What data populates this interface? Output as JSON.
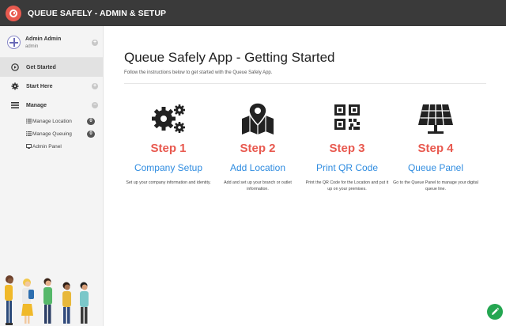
{
  "app": {
    "title": "QUEUE SAFELY - ADMIN & SETUP"
  },
  "user": {
    "name": "Admin Admin",
    "role": "admin"
  },
  "nav": {
    "get_started": "Get Started",
    "start_here": "Start Here",
    "manage": "Manage",
    "manage_items": [
      {
        "label": "Manage Location",
        "count": "0"
      },
      {
        "label": "Manage Queuing",
        "count": "0"
      },
      {
        "label": "Admin Panel"
      }
    ]
  },
  "main": {
    "title": "Queue Safely App - Getting Started",
    "subtitle": "Follow the instructions below to get started with the Queue Safely App.",
    "steps": [
      {
        "icon": "gears-icon",
        "number": "Step 1",
        "link": "Company Setup",
        "description": "Set up your company information and identity."
      },
      {
        "icon": "map-location-icon",
        "number": "Step 2",
        "link": "Add Location",
        "description": "Add and set up your branch or outlet information."
      },
      {
        "icon": "qr-code-icon",
        "number": "Step 3",
        "link": "Print QR Code",
        "description": "Print the QR Code for the Location and put it up on your premises."
      },
      {
        "icon": "solar-panel-icon",
        "number": "Step 4",
        "link": "Queue Panel",
        "description": "Go to the Queue Panel to manage your digital queue line."
      }
    ]
  },
  "colors": {
    "accent": "#e8594f",
    "link": "#2f8ce0",
    "topbar": "#3a3a3a",
    "fab": "#24a651"
  }
}
